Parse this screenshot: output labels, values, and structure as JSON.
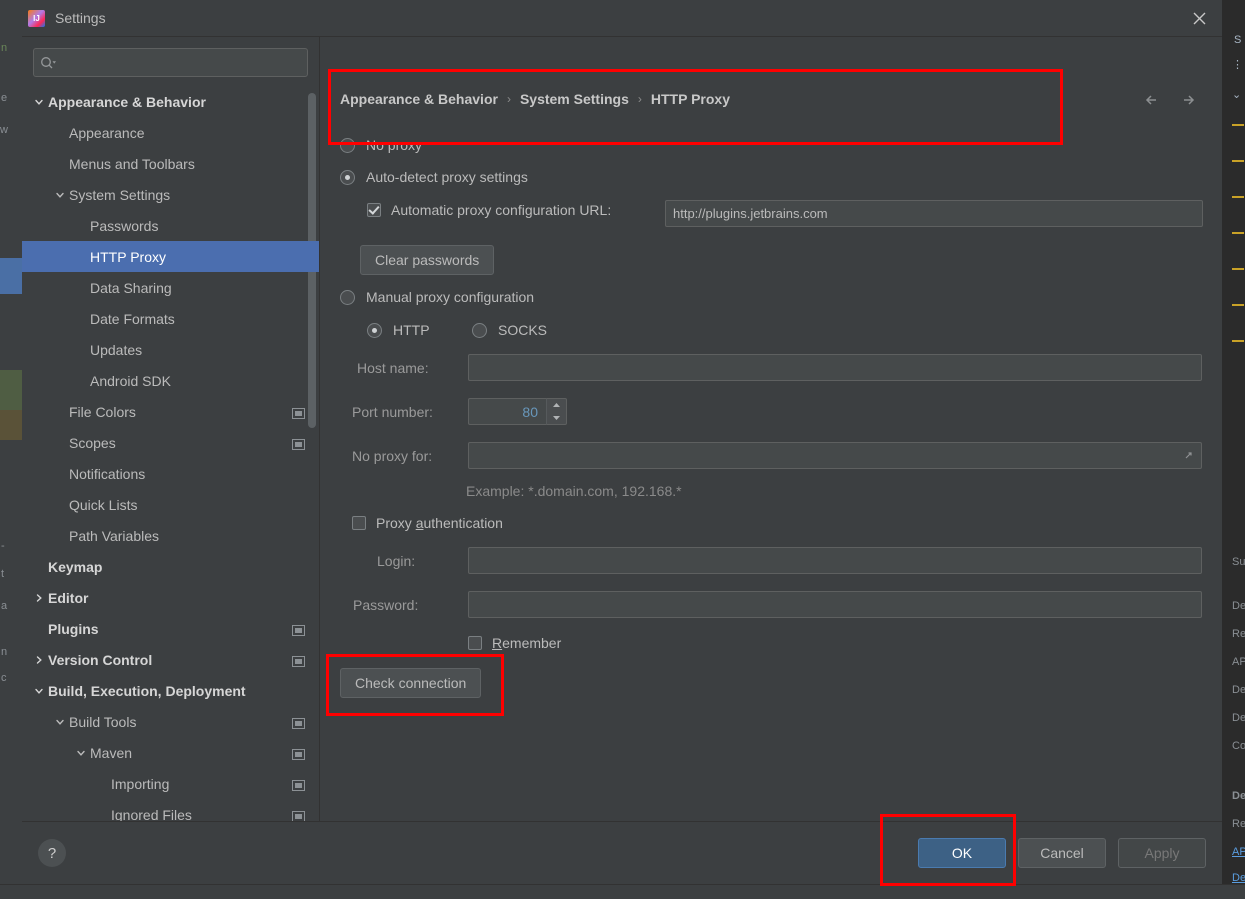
{
  "window": {
    "title": "Settings",
    "app_icon": "intellij-idea-icon",
    "close_icon": "close-icon"
  },
  "sidebar": {
    "search": {
      "placeholder": "",
      "value": "",
      "icon": "search-icon"
    },
    "items": [
      {
        "label": "Appearance & Behavior",
        "indent": 0,
        "twisty": "expanded",
        "bold": true,
        "badge": false,
        "selected": false
      },
      {
        "label": "Appearance",
        "indent": 1,
        "twisty": "none",
        "bold": false,
        "badge": false,
        "selected": false
      },
      {
        "label": "Menus and Toolbars",
        "indent": 1,
        "twisty": "none",
        "bold": false,
        "badge": false,
        "selected": false
      },
      {
        "label": "System Settings",
        "indent": 1,
        "twisty": "expanded",
        "bold": false,
        "badge": false,
        "selected": false
      },
      {
        "label": "Passwords",
        "indent": 2,
        "twisty": "none",
        "bold": false,
        "badge": false,
        "selected": false
      },
      {
        "label": "HTTP Proxy",
        "indent": 2,
        "twisty": "none",
        "bold": false,
        "badge": false,
        "selected": true
      },
      {
        "label": "Data Sharing",
        "indent": 2,
        "twisty": "none",
        "bold": false,
        "badge": false,
        "selected": false
      },
      {
        "label": "Date Formats",
        "indent": 2,
        "twisty": "none",
        "bold": false,
        "badge": false,
        "selected": false
      },
      {
        "label": "Updates",
        "indent": 2,
        "twisty": "none",
        "bold": false,
        "badge": false,
        "selected": false
      },
      {
        "label": "Android SDK",
        "indent": 2,
        "twisty": "none",
        "bold": false,
        "badge": false,
        "selected": false
      },
      {
        "label": "File Colors",
        "indent": 1,
        "twisty": "none",
        "bold": false,
        "badge": true,
        "selected": false
      },
      {
        "label": "Scopes",
        "indent": 1,
        "twisty": "none",
        "bold": false,
        "badge": true,
        "selected": false
      },
      {
        "label": "Notifications",
        "indent": 1,
        "twisty": "none",
        "bold": false,
        "badge": false,
        "selected": false
      },
      {
        "label": "Quick Lists",
        "indent": 1,
        "twisty": "none",
        "bold": false,
        "badge": false,
        "selected": false
      },
      {
        "label": "Path Variables",
        "indent": 1,
        "twisty": "none",
        "bold": false,
        "badge": false,
        "selected": false
      },
      {
        "label": "Keymap",
        "indent": 0,
        "twisty": "none",
        "bold": true,
        "badge": false,
        "selected": false
      },
      {
        "label": "Editor",
        "indent": 0,
        "twisty": "collapsed",
        "bold": true,
        "badge": false,
        "selected": false
      },
      {
        "label": "Plugins",
        "indent": 0,
        "twisty": "none",
        "bold": true,
        "badge": true,
        "selected": false
      },
      {
        "label": "Version Control",
        "indent": 0,
        "twisty": "collapsed",
        "bold": true,
        "badge": true,
        "selected": false
      },
      {
        "label": "Build, Execution, Deployment",
        "indent": 0,
        "twisty": "expanded",
        "bold": true,
        "badge": false,
        "selected": false
      },
      {
        "label": "Build Tools",
        "indent": 1,
        "twisty": "expanded",
        "bold": false,
        "badge": true,
        "selected": false
      },
      {
        "label": "Maven",
        "indent": 2,
        "twisty": "expanded",
        "bold": false,
        "badge": true,
        "selected": false
      },
      {
        "label": "Importing",
        "indent": 3,
        "twisty": "none",
        "bold": false,
        "badge": true,
        "selected": false
      },
      {
        "label": "Ignored Files",
        "indent": 3,
        "twisty": "none",
        "bold": false,
        "badge": true,
        "selected": false
      }
    ]
  },
  "content": {
    "breadcrumb": [
      "Appearance & Behavior",
      "System Settings",
      "HTTP Proxy"
    ],
    "breadcrumb_separator": "›",
    "nav_back_icon": "arrow-left-icon",
    "nav_forward_icon": "arrow-right-icon",
    "proxy_mode": {
      "no_proxy": "No proxy",
      "auto_detect": "Auto-detect proxy settings",
      "manual": "Manual proxy configuration",
      "selected": "auto_detect"
    },
    "auto_pac": {
      "checkbox_label": "Automatic proxy configuration URL:",
      "checked": true,
      "url_value": "http://plugins.jetbrains.com"
    },
    "clear_passwords_label": "Clear passwords",
    "protocol": {
      "http": "HTTP",
      "socks": "SOCKS",
      "selected": "http"
    },
    "host_name": {
      "label": "Host name:",
      "value": ""
    },
    "port_number": {
      "label": "Port number:",
      "value": "80"
    },
    "no_proxy_for": {
      "label": "No proxy for:",
      "value": "",
      "expand_icon": "expand-icon"
    },
    "example_hint": "Example: *.domain.com, 192.168.*",
    "proxy_auth": {
      "label": "Proxy authentication",
      "checked": false
    },
    "login": {
      "label": "Login:",
      "value": ""
    },
    "password": {
      "label": "Password:",
      "value": ""
    },
    "remember": {
      "label": "Remember",
      "checked": false
    },
    "check_connection_label": "Check connection"
  },
  "footer": {
    "help_icon": "help-icon",
    "help_label": "?",
    "ok": "OK",
    "cancel": "Cancel",
    "apply": "Apply",
    "apply_disabled": true
  },
  "annotations": {
    "highlight_color": "#ff0000",
    "boxes": [
      "auto-detect-proxy-section",
      "check-connection-button",
      "ok-button"
    ]
  },
  "colors": {
    "dialog_bg": "#3c3f41",
    "selection_blue": "#4b6eaf",
    "primary_button": "#3d6185",
    "field_bg": "#45494a",
    "text": "#bbbbbb",
    "number_blue": "#6897bb"
  },
  "background_ide": {
    "right_fragments": [
      "S",
      "Su",
      "De",
      "Re",
      "AP",
      "De",
      "De",
      "Co",
      "De",
      "Re",
      "AP",
      "De"
    ],
    "left_fragments": [
      "n",
      "e",
      "w",
      "t",
      "a",
      "n",
      "c"
    ]
  }
}
